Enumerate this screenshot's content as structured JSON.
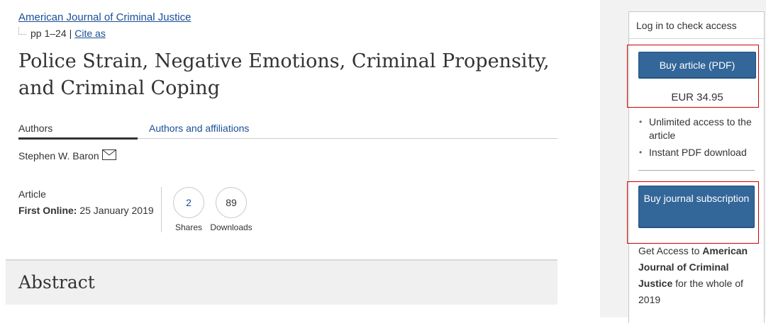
{
  "journal": {
    "name": "American Journal of Criminal Justice"
  },
  "pages": {
    "range": "pp 1–24",
    "separator": "|",
    "cite_label": "Cite as"
  },
  "article": {
    "title": "Police Strain, Negative Emotions, Criminal Propensity, and Criminal Coping",
    "type": "Article",
    "first_online_label": "First Online:",
    "first_online_date": "25 January 2019"
  },
  "tabs": [
    {
      "label": "Authors",
      "active": true
    },
    {
      "label": "Authors and affiliations",
      "active": false
    }
  ],
  "authors": [
    {
      "name": "Stephen W. Baron",
      "icon": "envelope-icon"
    }
  ],
  "metrics": {
    "shares": {
      "value": "2",
      "label": "Shares"
    },
    "downloads": {
      "value": "89",
      "label": "Downloads"
    }
  },
  "abstract": {
    "heading": "Abstract"
  },
  "sidebar": {
    "header": "Log in to check access",
    "buy_article_label": "Buy article (PDF)",
    "price": "EUR 34.95",
    "features": [
      "Unlimited access to the article",
      "Instant PDF download"
    ],
    "buy_subscription_label": "Buy journal subscription",
    "access_prefix": "Get Access to",
    "access_journal": "American Journal of Criminal Justice",
    "access_suffix": "for the whole of 2019"
  },
  "colors": {
    "link": "#1a4f96",
    "button": "#336699",
    "highlight": "#cc0000",
    "sidebar_bg": "#f2f2f2"
  }
}
